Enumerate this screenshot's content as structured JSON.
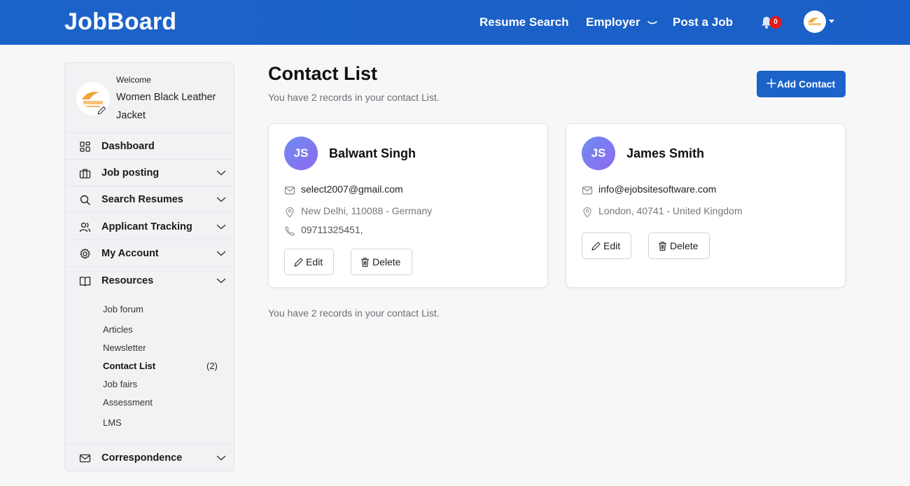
{
  "navbar": {
    "brand": "JobBoard",
    "links": {
      "resume_search": "Resume Search",
      "employer": "Employer",
      "post_job": "Post a Job"
    },
    "notification_count": "0",
    "colors": {
      "bar": "#1c63c9",
      "badge": "#e01b1b"
    }
  },
  "sidebar": {
    "welcome": "Welcome",
    "company_name": "Women Black Leather Jacket",
    "menu": {
      "dashboard": "Dashboard",
      "job_posting": "Job posting",
      "search_resumes": "Search Resumes",
      "applicant_tracking": "Applicant Tracking",
      "my_account": "My Account",
      "resources": "Resources",
      "correspondence": "Correspondence"
    },
    "resources_sub": {
      "job_forum": "Job forum",
      "articles": "Articles",
      "newsletter": "Newsletter",
      "contact_list": "Contact List",
      "contact_list_count": "(2)",
      "job_fairs": "Job fairs",
      "assessment": "Assessment",
      "lms": "LMS"
    }
  },
  "main": {
    "title": "Contact List",
    "records_text": "You have 2 records in your contact List.",
    "add_button": "Add Contact",
    "contacts": [
      {
        "initials": "JS",
        "name": "Balwant Singh",
        "email": "select2007@gmail.com",
        "location": "New Delhi, 110088 - Germany",
        "phone": "09711325451,",
        "edit": "Edit",
        "delete": "Delete"
      },
      {
        "initials": "JS",
        "name": "James Smith",
        "email": "info@ejobsitesoftware.com",
        "location": "London, 40741 - United Kingdom",
        "edit": "Edit",
        "delete": "Delete"
      }
    ]
  }
}
